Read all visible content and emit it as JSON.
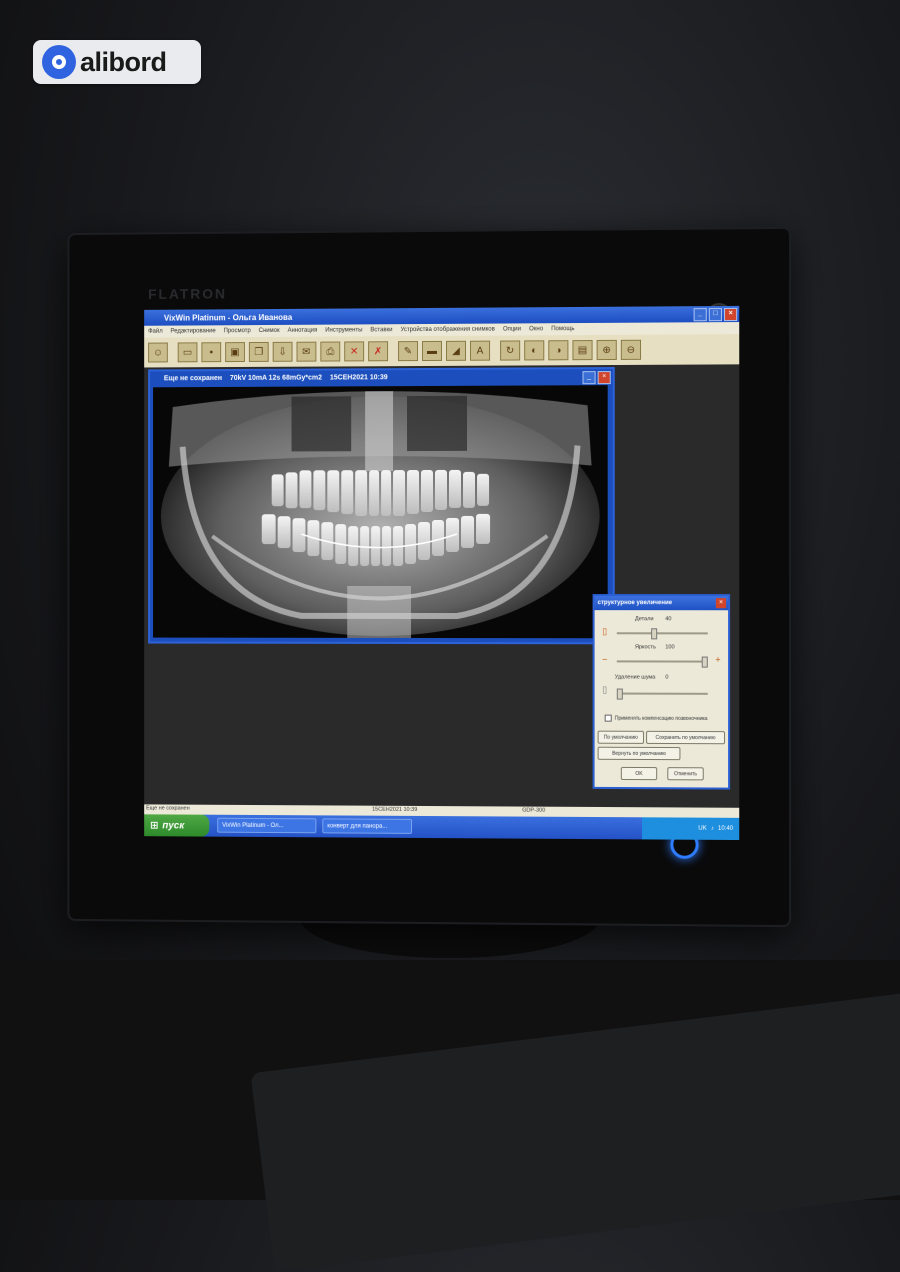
{
  "watermark": {
    "text": "alibord"
  },
  "monitor": {
    "brand": "FLATRON"
  },
  "app": {
    "title": "VixWin Platinum - Ольга Иванова",
    "menu": [
      "Файл",
      "Редактирование",
      "Просмотр",
      "Снимок",
      "Аннотация",
      "Инструменты",
      "Вставки",
      "Устройства отображения снимков",
      "Опции",
      "Окно",
      "Помощь"
    ]
  },
  "image_window": {
    "title": "Еще не сохранен",
    "exposure": "70kV 10mA 12s 68mGy*cm2",
    "date": "15СЕН2021 10:39"
  },
  "dialog": {
    "title": "структурное увеличение",
    "detail_label": "Детали",
    "detail_value": "40",
    "brightness_label": "Яркость",
    "brightness_value": "100",
    "noise_label": "Удаление шума",
    "noise_value": "0",
    "checkbox_label": "Применять компенсацию позвоночника",
    "btn_default": "По умолчанию",
    "btn_save_default": "Сохранить по умолчанию",
    "btn_restore_default": "Вернуть по умолчанию",
    "btn_ok": "OK",
    "btn_cancel": "Отменить",
    "levels": {
      "detail": 0.4,
      "brightness": 1.0,
      "noise": 0.0
    }
  },
  "statusbar": {
    "left": "Еще не сохранен",
    "date": "15СЕН2021 10:39",
    "device": "GDP-300"
  },
  "taskbar": {
    "start": "пуск",
    "tasks": [
      "VixWin Platinum - Ол...",
      "конверт для панора..."
    ],
    "tray_lang": "UK",
    "clock": "10:40"
  },
  "colors": {
    "titlebar": "#1d4ec2",
    "taskbar": "#2452c6",
    "start": "#2d8a2a",
    "power_led": "#2f7dff"
  }
}
